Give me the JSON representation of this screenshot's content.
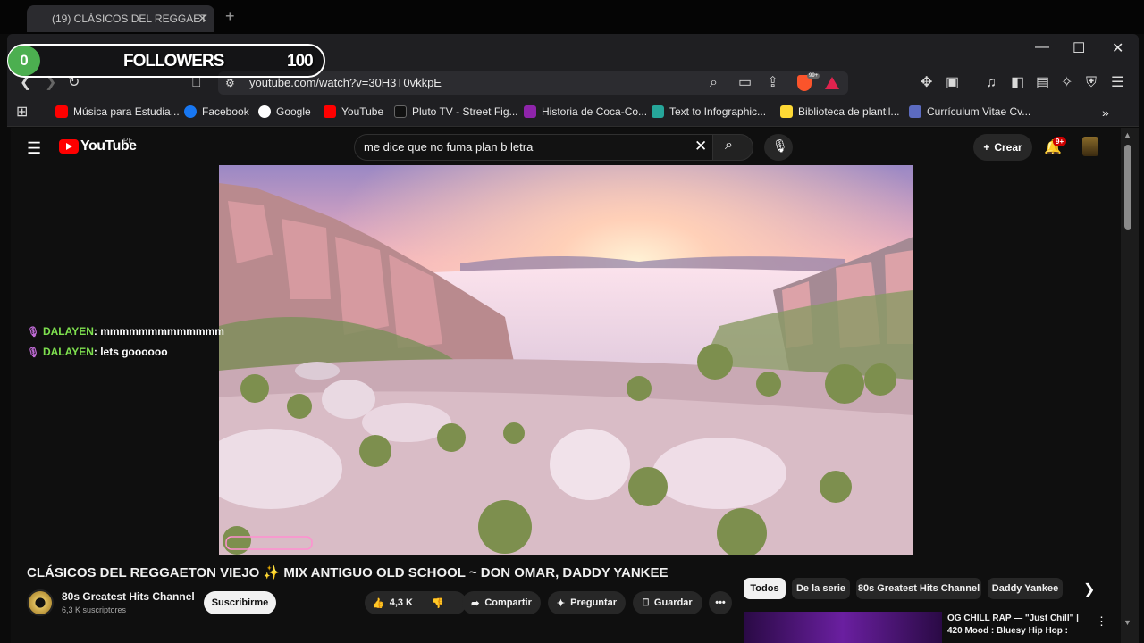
{
  "browser": {
    "tab_title": "(19) CLÁSICOS DEL REGGAET",
    "tab_close": "✕",
    "new_tab": "+",
    "url": "youtube.com/watch?v=30H3T0vkkpE",
    "window_controls": {
      "minimize": "—",
      "maximize": "☐",
      "close": "✕"
    },
    "brave_badge": "99+",
    "bookmarks": [
      {
        "label": "Música para Estudia...",
        "color": "#ff0000"
      },
      {
        "label": "Facebook",
        "color": "#1877f2"
      },
      {
        "label": "Google",
        "color": "#ffffff"
      },
      {
        "label": "YouTube",
        "color": "#ff0000"
      },
      {
        "label": "Pluto TV - Street Fig...",
        "color": "#111111"
      },
      {
        "label": "Historia de Coca-Co...",
        "color": "#8e24aa"
      },
      {
        "label": "Text to Infographic...",
        "color": "#26a69a"
      },
      {
        "label": "Biblioteca de plantil...",
        "color": "#fdd835"
      },
      {
        "label": "Currículum Vitae Cv...",
        "color": "#5c6bc0"
      }
    ],
    "bookmarks_more": "»"
  },
  "overlay": {
    "followers_count": "0",
    "followers_label": "FOLLOWERS",
    "followers_goal": "100",
    "chat": [
      {
        "user": "DALAYEN",
        "message": ": mmmmmmmmmmmmm"
      },
      {
        "user": "DALAYEN",
        "message": ": lets goooooo"
      }
    ]
  },
  "youtube": {
    "logo_text": "YouTube",
    "region": "PE",
    "search_query": "me dice que no fuma plan b letra",
    "create_label": "Crear",
    "notif_badge": "9+",
    "video_title": "CLÁSICOS DEL REGGAETON VIEJO ✨ MIX ANTIGUO OLD SCHOOL ~ DON OMAR, DADDY YANKEE",
    "channel_name": "80s Greatest Hits Channel",
    "subscribers": "6,3 K suscriptores",
    "subscribe_label": "Suscribirme",
    "likes": "4,3 K",
    "share_label": "Compartir",
    "ask_label": "Preguntar",
    "save_label": "Guardar",
    "more_label": "•••",
    "chips": [
      "Todos",
      "De la serie",
      "80s Greatest Hits Channel",
      "Daddy Yankee"
    ],
    "recommended_title": "OG CHILL RAP — \"Just Chill\" | 420 Mood : Bluesy Hip Hop :"
  }
}
